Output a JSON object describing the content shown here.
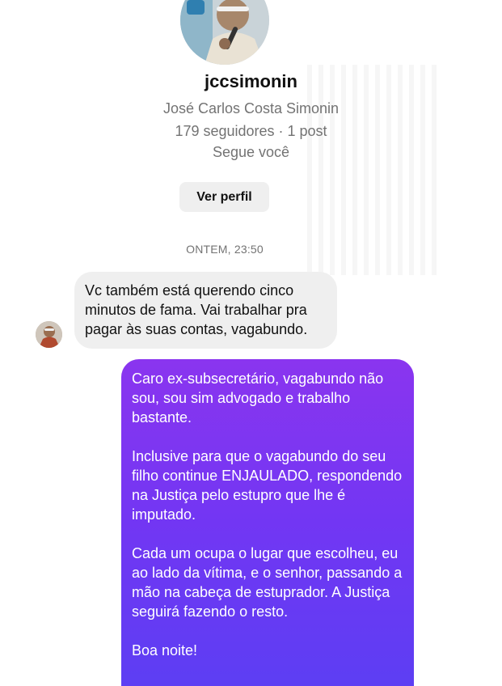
{
  "profile": {
    "username": "jccsimonin",
    "full_name": "José Carlos Costa Simonin",
    "stats": "179 seguidores · 1 post",
    "follows_you": "Segue você",
    "view_profile_label": "Ver perfil"
  },
  "conversation": {
    "timestamp": "ONTEM, 23:50",
    "messages": [
      {
        "direction": "received",
        "paragraphs": [
          "Vc também está querendo cinco minutos de fama. Vai trabalhar pra pagar às suas contas, vagabundo."
        ]
      },
      {
        "direction": "sent",
        "paragraphs": [
          "Caro ex-subsecretário, vagabundo não sou, sou sim advogado e trabalho bastante.",
          "Inclusive para que o vagabundo do seu filho continue ENJAULADO, respondendo na Justiça pelo estupro que lhe é imputado.",
          "Cada um ocupa o lugar que escolheu, eu ao lado da vítima, e o senhor, passando a mão na cabeça de estuprador. A Justiça seguirá fazendo o resto.",
          "Boa noite!"
        ]
      }
    ]
  },
  "colors": {
    "sent_bubble_top": "#8a35ef",
    "sent_bubble_bottom": "#5a3ff3",
    "received_bubble": "#efefef",
    "secondary_text": "#737373"
  }
}
